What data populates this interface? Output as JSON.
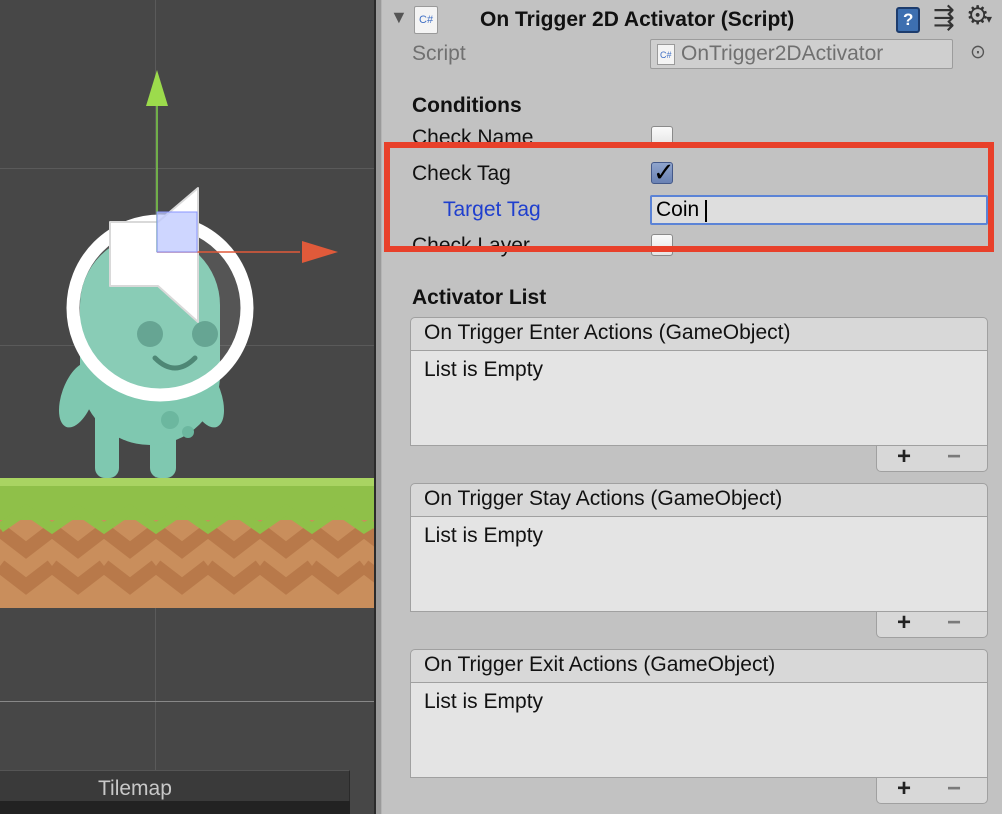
{
  "scene": {
    "tilemap_label": "Tilemap"
  },
  "component": {
    "title": "On Trigger 2D Activator (Script)",
    "script_label": "Script",
    "script_value": "OnTrigger2DActivator",
    "file_icon_text": "C#"
  },
  "conditions": {
    "heading": "Conditions",
    "check_name_label": "Check Name",
    "check_name_checked": false,
    "check_tag_label": "Check Tag",
    "check_tag_checked": true,
    "target_tag_label": "Target Tag",
    "target_tag_value": "Coin",
    "check_layer_label": "Check Layer",
    "check_layer_checked": false
  },
  "activator": {
    "heading": "Activator List",
    "lists": [
      {
        "header": "On Trigger Enter Actions (GameObject)",
        "empty_text": "List is Empty"
      },
      {
        "header": "On Trigger Stay Actions (GameObject)",
        "empty_text": "List is Empty"
      },
      {
        "header": "On Trigger Exit Actions (GameObject)",
        "empty_text": "List is Empty"
      }
    ],
    "add_label": "+",
    "remove_label": "−"
  },
  "colors": {
    "highlight": "#e8402a",
    "accent_label": "#1f3fce",
    "grass": "#8fc049",
    "dirt": "#c98e5c",
    "character": "#7fc8b0"
  }
}
